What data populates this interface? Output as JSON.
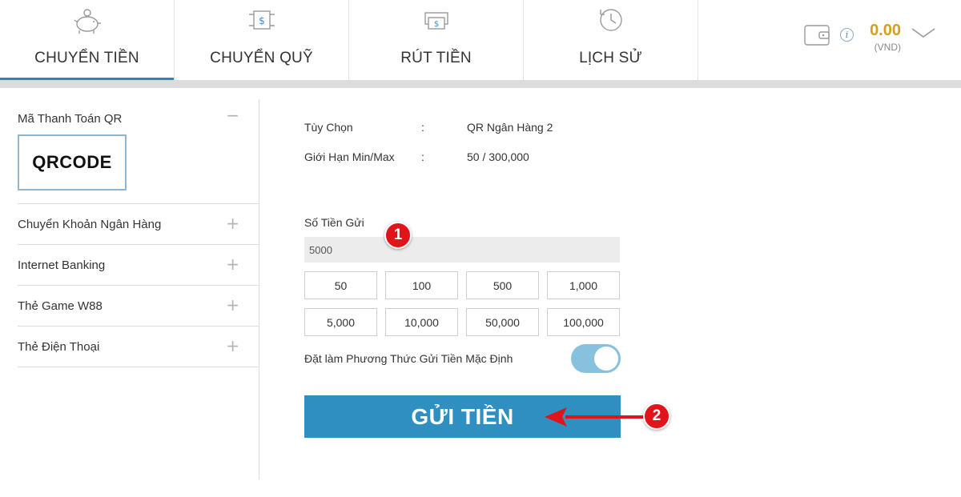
{
  "nav": {
    "tabs": [
      {
        "label": "CHUYỂN TIỀN",
        "icon": "piggy-bank-icon",
        "active": true
      },
      {
        "label": "CHUYỂN QUỸ",
        "icon": "fund-transfer-icon",
        "active": false
      },
      {
        "label": "RÚT TIỀN",
        "icon": "cash-withdraw-icon",
        "active": false
      },
      {
        "label": "LỊCH SỬ",
        "icon": "history-clock-icon",
        "active": false
      }
    ]
  },
  "wallet": {
    "balance": "0.00",
    "currency": "(VND)",
    "info_glyph": "i"
  },
  "sidebar": {
    "items": [
      {
        "label": "Mã Thanh Toán QR",
        "toggle": "−",
        "expanded": true
      },
      {
        "label": "Chuyển Khoản Ngân Hàng",
        "toggle": "+"
      },
      {
        "label": "Internet Banking",
        "toggle": "+"
      },
      {
        "label": "Thẻ Game W88",
        "toggle": "+"
      },
      {
        "label": "Thẻ Điện Thoại",
        "toggle": "+"
      }
    ],
    "qr_logo_text": "QRCODE"
  },
  "form": {
    "option_label": "Tùy Chọn",
    "option_value": "QR Ngân Hàng 2",
    "limit_label": "Giới Hạn Min/Max",
    "limit_value": "50 / 300,000",
    "separator": ":",
    "amount_label": "Số Tiền Gửi",
    "amount_value": "5000",
    "quick_amounts": [
      "50",
      "100",
      "500",
      "1,000",
      "5,000",
      "10,000",
      "50,000",
      "100,000"
    ],
    "default_label": "Đặt làm Phương Thức Gửi Tiền Mặc Định",
    "default_on": true,
    "submit_label": "GỬI TIỀN"
  },
  "annotations": {
    "step1": "1",
    "step2": "2"
  },
  "colors": {
    "accent": "#2b87bb",
    "submit": "#2f8fc0",
    "balance": "#d4a017",
    "badge": "#e2141b",
    "toggle_on": "#86c1de"
  }
}
